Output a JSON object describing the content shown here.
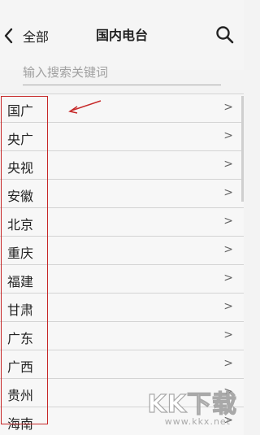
{
  "header": {
    "back_label": "全部",
    "title": "国内电台"
  },
  "search": {
    "placeholder": "输入搜索关键词"
  },
  "list": {
    "items": [
      {
        "label": "国广"
      },
      {
        "label": "央广"
      },
      {
        "label": "央视"
      },
      {
        "label": "安徽"
      },
      {
        "label": "北京"
      },
      {
        "label": "重庆"
      },
      {
        "label": "福建"
      },
      {
        "label": "甘肃"
      },
      {
        "label": "广东"
      },
      {
        "label": "广西"
      },
      {
        "label": "贵州"
      },
      {
        "label": "海南"
      }
    ],
    "chevron": ">"
  },
  "annotation": {
    "highlight_color": "#c62828"
  },
  "watermark": {
    "brand": "KK下载",
    "url": "www.kkx.net"
  }
}
